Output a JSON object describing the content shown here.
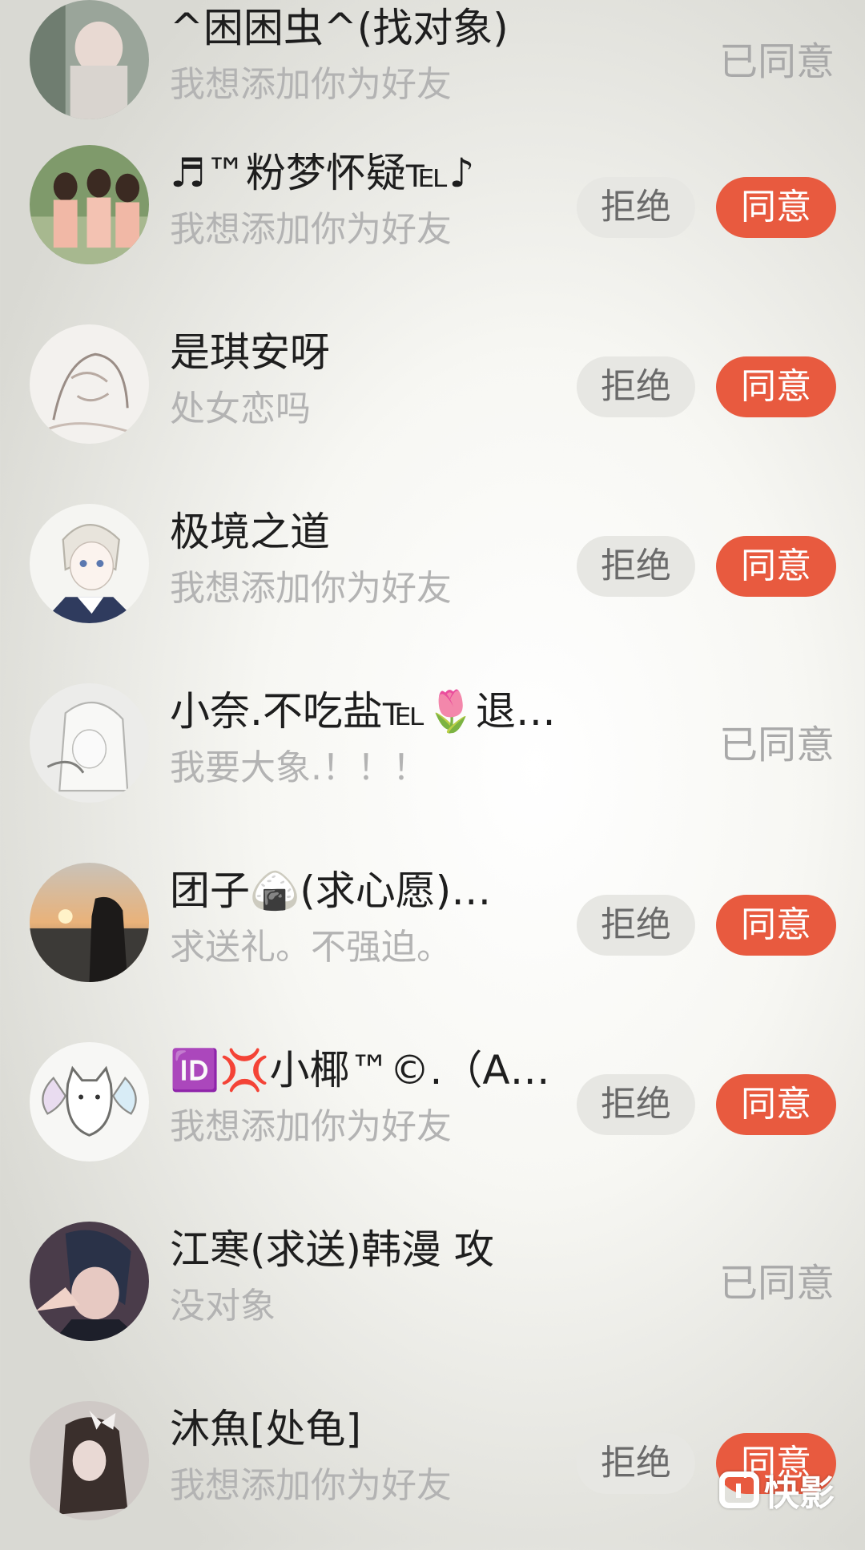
{
  "requests": [
    {
      "name": "^困困虫^(找对象)",
      "message": "我想添加你为好友",
      "status": "已同意",
      "avatar": "avatar-girl-photo"
    },
    {
      "name": "♬™粉梦怀疑℡♪",
      "message": "我想添加你为好友",
      "reject_label": "拒绝",
      "accept_label": "同意",
      "avatar": "avatar-group-photo"
    },
    {
      "name": "是琪安呀",
      "message": "处女恋吗",
      "reject_label": "拒绝",
      "accept_label": "同意",
      "avatar": "avatar-sketch"
    },
    {
      "name": "极境之道",
      "message": "我想添加你为好友",
      "reject_label": "拒绝",
      "accept_label": "同意",
      "avatar": "avatar-anime-boy"
    },
    {
      "name": "小奈.不吃盐℡🌷退了，…",
      "message": "我要大象.！！！",
      "status": "已同意",
      "avatar": "avatar-anime-girl"
    },
    {
      "name": "团子🍙(求心愿)…",
      "message": "求送礼。不强迫。",
      "reject_label": "拒绝",
      "accept_label": "同意",
      "avatar": "avatar-sunset"
    },
    {
      "name": "🆔💢小椰™©.（A…",
      "message": "我想添加你为好友",
      "reject_label": "拒绝",
      "accept_label": "同意",
      "avatar": "avatar-cat-butterfly"
    },
    {
      "name": "江寒(求送)韩漫 攻",
      "message": "没对象",
      "status": "已同意",
      "avatar": "avatar-manga-boy"
    },
    {
      "name": "沐魚[处龟]",
      "message": "我想添加你为好友",
      "reject_label": "拒绝",
      "accept_label": "同意",
      "avatar": "avatar-girl-bow"
    }
  ],
  "watermark": {
    "text": "快影",
    "icon": "kuaiying-logo-icon"
  },
  "colors": {
    "accent": "#e85a3f",
    "reject_bg": "#e7e7e3",
    "status_text": "#a9a9a9",
    "message_text": "#b3b3b3"
  }
}
